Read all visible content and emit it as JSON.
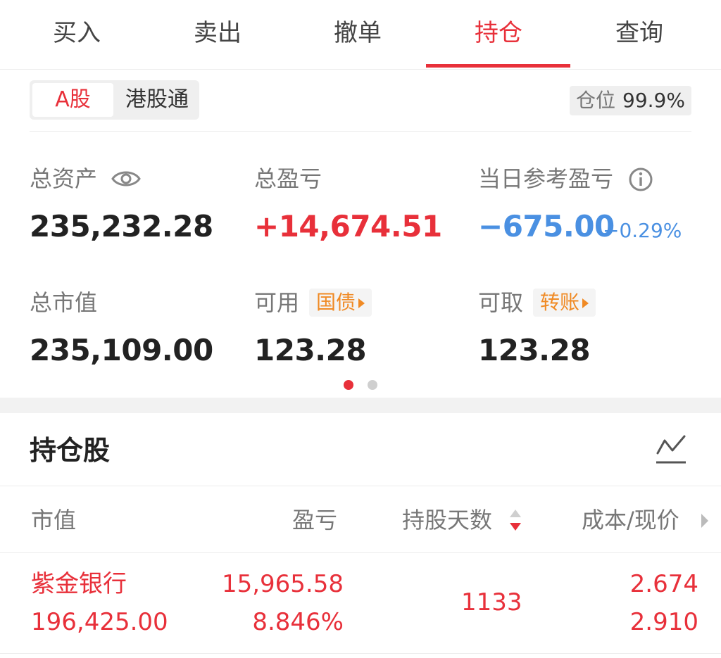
{
  "tabs": [
    "买入",
    "卖出",
    "撤单",
    "持仓",
    "查询"
  ],
  "active_tab": "持仓",
  "market_segment": {
    "a_share": "A股",
    "hk_connect": "港股通",
    "selected": "A股"
  },
  "position_ratio": {
    "label": "仓位",
    "value": "99.9%"
  },
  "summary": {
    "total_assets": {
      "label": "总资产",
      "value": "235,232.28"
    },
    "total_pnl": {
      "label": "总盈亏",
      "value": "+14,674.51"
    },
    "daily_pnl": {
      "label": "当日参考盈亏",
      "value": "−675.00",
      "percent": "−0.29%"
    },
    "market_value": {
      "label": "总市值",
      "value": "235,109.00"
    },
    "available": {
      "label": "可用",
      "chip": "国债",
      "value": "123.28"
    },
    "withdrawable": {
      "label": "可取",
      "chip": "转账",
      "value": "123.28"
    }
  },
  "holdings": {
    "title": "持仓股",
    "columns": {
      "market_value": "市值",
      "pnl": "盈亏",
      "days": "持股天数",
      "cost_price": "成本/现价"
    },
    "rows": [
      {
        "name": "紫金银行",
        "market_value": "196,425.00",
        "pnl": "15,965.58",
        "pnl_pct": "8.846%",
        "days": "1133",
        "cost": "2.674",
        "price": "2.910"
      }
    ]
  },
  "colors": {
    "accent_red": "#e8303a",
    "blue": "#4a90e2",
    "orange": "#f08a24"
  }
}
